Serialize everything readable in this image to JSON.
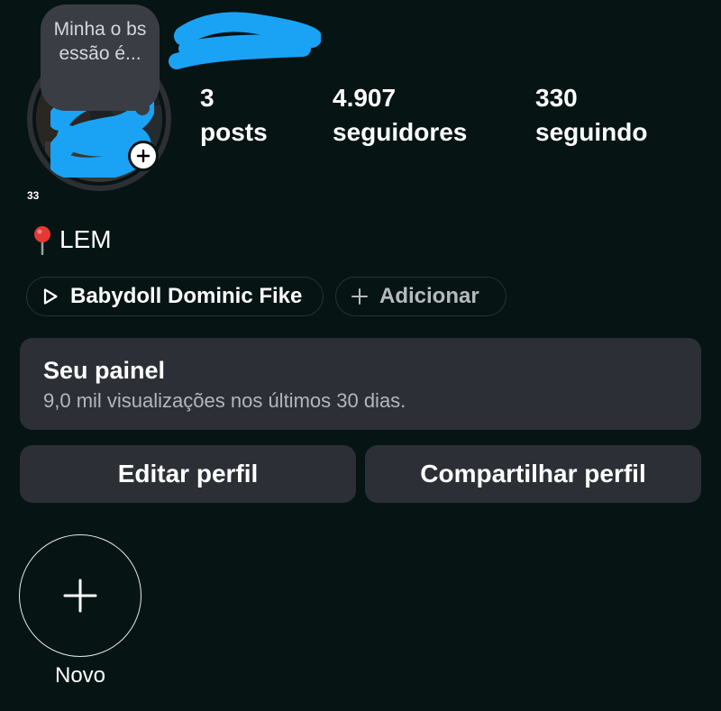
{
  "profile": {
    "note": "Minha o bsessão é...",
    "small_count": "33",
    "bio": "LEM",
    "icons": {
      "pin": "location-pin-icon",
      "add_story": "plus-icon",
      "play": "play-icon"
    }
  },
  "stats": {
    "posts": {
      "value": "3",
      "label": "posts"
    },
    "followers": {
      "value": "4.907",
      "label": "seguidores"
    },
    "following": {
      "value": "330",
      "label": "seguindo"
    }
  },
  "chips": {
    "music": "Babydoll Dominic Fike",
    "add": "Adicionar"
  },
  "dashboard": {
    "title": "Seu painel",
    "subtitle": "9,0 mil visualizações nos últimos 30 dias."
  },
  "buttons": {
    "edit": "Editar perfil",
    "share": "Compartilhar perfil"
  },
  "highlights": {
    "new_label": "Novo"
  },
  "colors": {
    "background": "#061414",
    "card": "#2c2f35",
    "redaction": "#1aa3f5"
  }
}
